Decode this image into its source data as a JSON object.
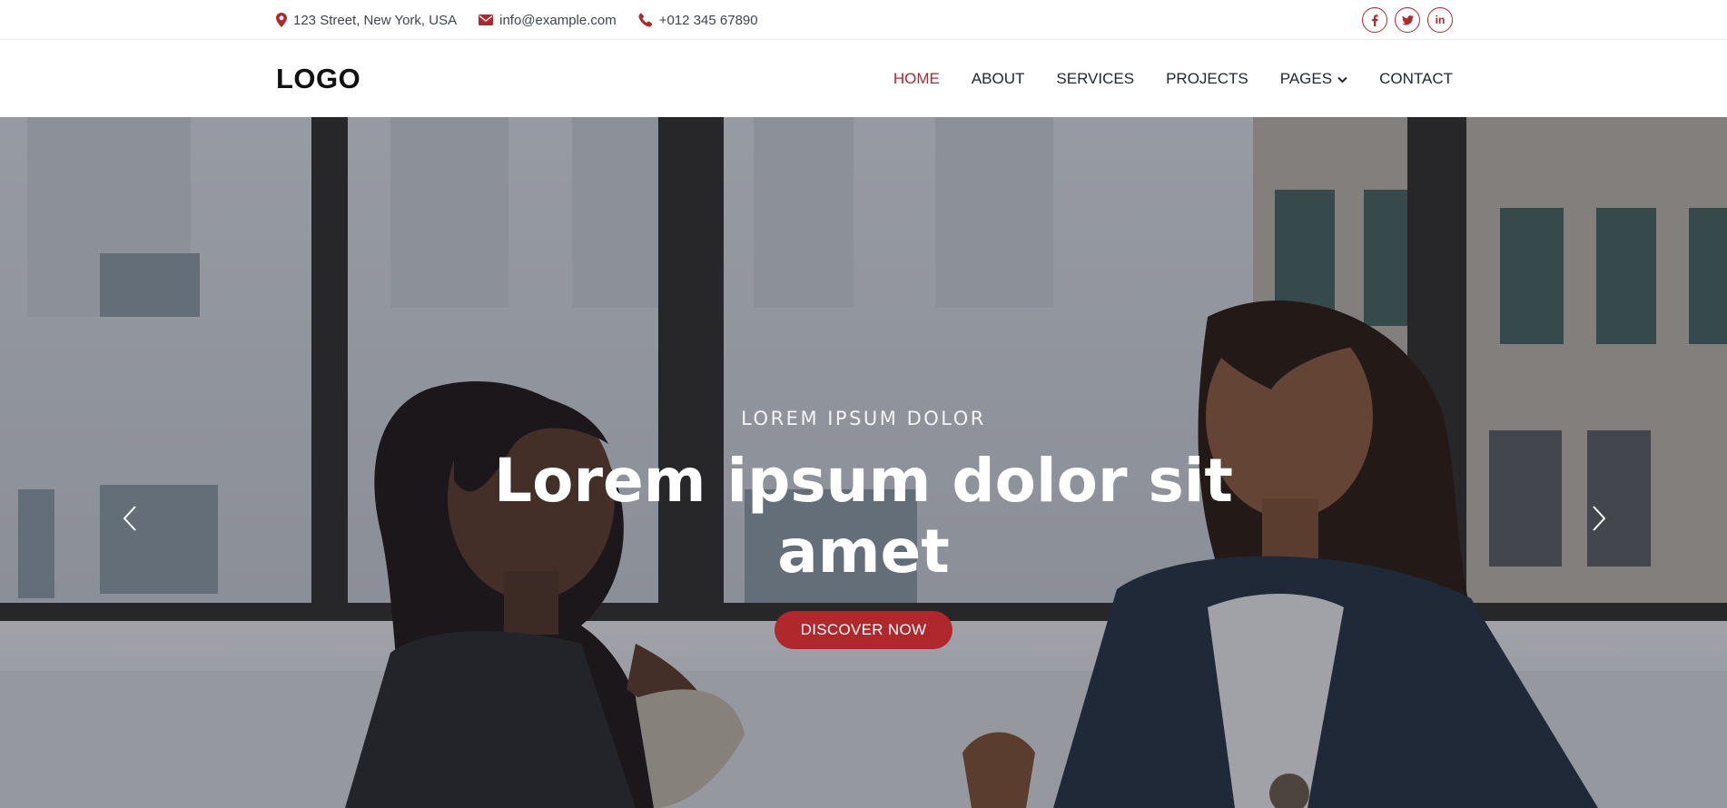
{
  "topbar": {
    "address": "123 Street, New York, USA",
    "email": "info@example.com",
    "phone": "+012 345 67890",
    "socials": [
      {
        "icon": "facebook-icon",
        "glyph": "f"
      },
      {
        "icon": "twitter-icon",
        "glyph": "t"
      },
      {
        "icon": "linkedin-icon",
        "glyph": "in"
      }
    ]
  },
  "nav": {
    "logo": "LOGO",
    "items": [
      {
        "label": "HOME",
        "active": true
      },
      {
        "label": "ABOUT",
        "active": false
      },
      {
        "label": "SERVICES",
        "active": false
      },
      {
        "label": "PROJECTS",
        "active": false
      },
      {
        "label": "PAGES",
        "active": false,
        "dropdown": true
      },
      {
        "label": "CONTACT",
        "active": false
      }
    ]
  },
  "hero": {
    "subtitle": "LOREM IPSUM DOLOR",
    "title_line1": "Lorem ipsum dolor sit",
    "title_line2": "amet",
    "cta_label": "DISCOVER NOW"
  },
  "colors": {
    "accent": "#b0282c",
    "text_dark": "#1e2533"
  }
}
